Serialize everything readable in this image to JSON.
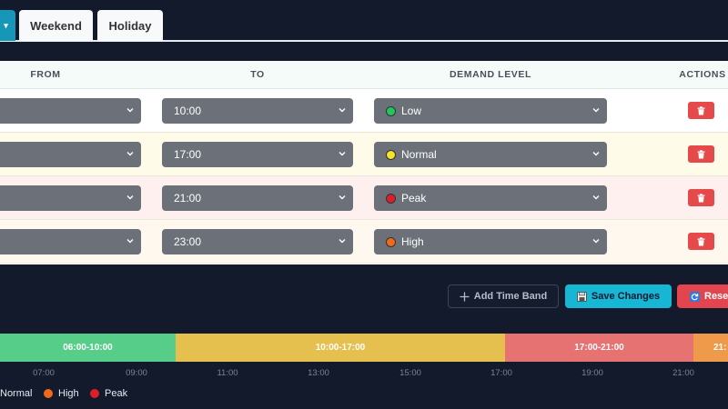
{
  "tabs": [
    {
      "label": "",
      "active": true
    },
    {
      "label": "Weekend",
      "active": false
    },
    {
      "label": "Holiday",
      "active": false
    }
  ],
  "table": {
    "headers": {
      "from": "FROM",
      "to": "TO",
      "demand": "DEMAND LEVEL",
      "actions": "ACTIONS"
    },
    "rows": [
      {
        "from": "",
        "to": "10:00",
        "demand": "Low",
        "dot_color": "#22c55e",
        "bg": "#ffffff"
      },
      {
        "from": "",
        "to": "17:00",
        "demand": "Normal",
        "dot_color": "#f5e52a",
        "bg": "#fefce8"
      },
      {
        "from": "",
        "to": "21:00",
        "demand": "Peak",
        "dot_color": "#dc1e2a",
        "bg": "#fdf0ef"
      },
      {
        "from": "",
        "to": "23:00",
        "demand": "High",
        "dot_color": "#f16a1a",
        "bg": "#fff8ee"
      }
    ]
  },
  "buttons": {
    "add": "Add Time Band",
    "save": "Save Changes",
    "reset": "Rese"
  },
  "timeline": {
    "segments": [
      {
        "label": "06:00-10:00",
        "color": "#57cd8a"
      },
      {
        "label": "10:00-17:00",
        "color": "#e6c04e"
      },
      {
        "label": "17:00-21:00",
        "color": "#e67272"
      },
      {
        "label": "21:",
        "color": "#ef9a4a"
      }
    ],
    "ticks": [
      "07:00",
      "09:00",
      "11:00",
      "13:00",
      "15:00",
      "17:00",
      "19:00",
      "21:00"
    ]
  },
  "legend": [
    {
      "label": "Normal",
      "color": null
    },
    {
      "label": "High",
      "color": "#f16a1a"
    },
    {
      "label": "Peak",
      "color": "#dc1e2a"
    }
  ],
  "icons": {
    "select_caret": "chevron-down-icon",
    "delete": "trash-icon",
    "add": "plus-icon",
    "save": "floppy-disk-icon",
    "reset": "refresh-icon"
  }
}
